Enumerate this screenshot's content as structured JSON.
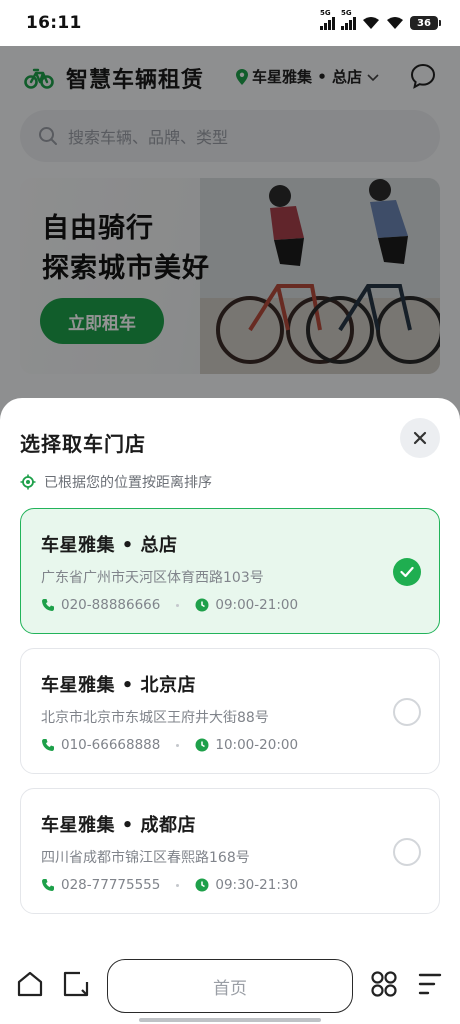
{
  "status_bar": {
    "time": "16:11",
    "network_1": "5G",
    "network_2": "5G",
    "battery": "36"
  },
  "header": {
    "app_title": "智慧车辆租赁",
    "location": "车星雅集 • 总店"
  },
  "search": {
    "placeholder": "搜索车辆、品牌、类型"
  },
  "banner": {
    "line1": "自由骑行",
    "line2": "探索城市美好",
    "cta": "立即租车"
  },
  "sheet": {
    "title": "选择取车门店",
    "hint": "已根据您的位置按距离排序",
    "stores": [
      {
        "name": "车星雅集 • 总店",
        "address": "广东省广州市天河区体育西路103号",
        "phone": "020-88886666",
        "hours": "09:00-21:00",
        "selected": true
      },
      {
        "name": "车星雅集 • 北京店",
        "address": "北京市北京市东城区王府井大街88号",
        "phone": "010-66668888",
        "hours": "10:00-20:00",
        "selected": false
      },
      {
        "name": "车星雅集 • 成都店",
        "address": "四川省成都市锦江区春熙路168号",
        "phone": "028-77775555",
        "hours": "09:30-21:30",
        "selected": false
      }
    ]
  },
  "bottom_nav": {
    "home_label": "首页"
  },
  "colors": {
    "accent": "#1ea04a",
    "selected_bg": "#e8f7ed",
    "selected_border": "#22b35a"
  }
}
